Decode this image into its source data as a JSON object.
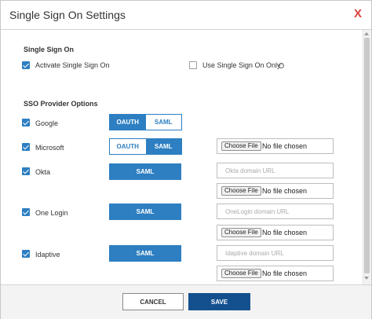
{
  "dialog": {
    "title": "Single Sign On Settings",
    "close_glyph": "X"
  },
  "sso": {
    "heading": "Single Sign On",
    "activate_label": "Activate Single Sign On",
    "activate_checked": true,
    "only_label": "Use Single Sign On Only",
    "only_checked": false,
    "help_glyph": "?"
  },
  "providers": {
    "heading": "SSO Provider Options",
    "google": {
      "label": "Google",
      "checked": true,
      "oauth": "OAUTH",
      "saml": "SAML",
      "selected": "OAUTH"
    },
    "microsoft": {
      "label": "Microsoft",
      "checked": true,
      "oauth": "OAUTH",
      "saml": "SAML",
      "selected": "SAML",
      "file_button": "Choose File",
      "file_status": "No file chosen"
    },
    "okta": {
      "label": "Okta",
      "checked": true,
      "saml": "SAML",
      "url_placeholder": "Okta domain URL",
      "file_button": "Choose File",
      "file_status": "No file chosen"
    },
    "onelogin": {
      "label": "One Login",
      "checked": true,
      "saml": "SAML",
      "url_placeholder": "OneLogin domain URL",
      "file_button": "Choose File",
      "file_status": "No file chosen"
    },
    "idaptive": {
      "label": "Idaptive",
      "checked": true,
      "saml": "SAML",
      "url_placeholder": "Idaptive domain URL",
      "file_button": "Choose File",
      "file_status": "No file chosen"
    }
  },
  "footer": {
    "cancel": "CANCEL",
    "save": "SAVE"
  },
  "colors": {
    "accent": "#2d7fc2",
    "save": "#14508e",
    "close": "#d9403a"
  }
}
